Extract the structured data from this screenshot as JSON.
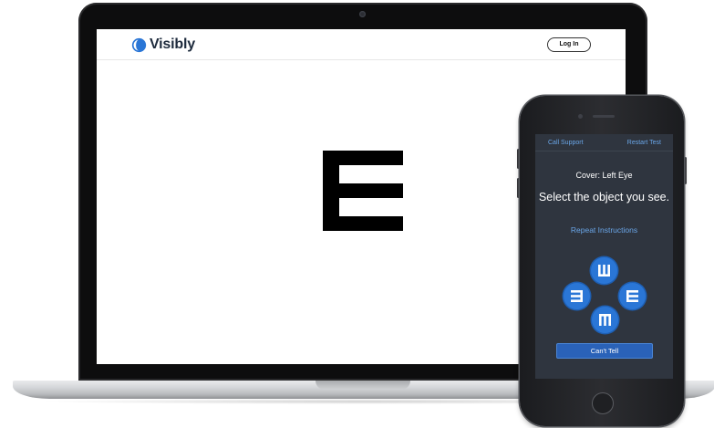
{
  "website": {
    "brand": "Visibly",
    "login_label": "Log In",
    "optotype": "E",
    "optotype_orientation": "right"
  },
  "phone": {
    "call_support": "Call Support",
    "restart_test": "Restart Test",
    "cover_eye": "Cover: Left Eye",
    "instruction": "Select the object you see.",
    "repeat_instructions": "Repeat Instructions",
    "choices": [
      {
        "orientation": "up",
        "icon": "e-up-icon"
      },
      {
        "orientation": "left",
        "icon": "e-left-icon"
      },
      {
        "orientation": "right",
        "icon": "e-right-icon"
      },
      {
        "orientation": "down",
        "icon": "e-down-icon"
      }
    ],
    "cant_tell": "Can't Tell"
  },
  "colors": {
    "accent_blue": "#2a76d6",
    "link_blue": "#6aa6e8",
    "phone_screen_bg": "#2f353f",
    "brand_navy": "#1d2a3c"
  }
}
